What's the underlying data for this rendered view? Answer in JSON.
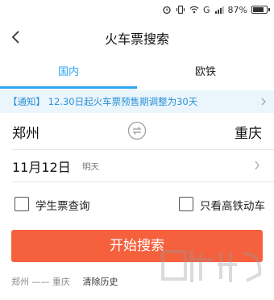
{
  "status_bar": {
    "battery_text": "87%",
    "battery_level": 0.87,
    "icons": [
      "alarm-icon",
      "vibrate-icon",
      "wifi-icon",
      "signal-icon",
      "battery-icon"
    ],
    "network_label": "G"
  },
  "header": {
    "title": "火车票搜索",
    "back_icon": "chevron-left-icon"
  },
  "tabs": [
    {
      "label": "国内",
      "active": true
    },
    {
      "label": "欧铁",
      "active": false
    }
  ],
  "notice": {
    "text": "【通知】 12.30日起火车票预售期调整为30天"
  },
  "route": {
    "from": "郑州",
    "to": "重庆",
    "swap_icon": "swap-icon"
  },
  "date": {
    "value": "11月12日",
    "relative": "明天"
  },
  "options": {
    "student": {
      "label": "学生票查询",
      "checked": false
    },
    "high_speed": {
      "label": "只看高铁动车",
      "checked": false
    }
  },
  "search_button": {
    "label": "开始搜索"
  },
  "history": {
    "route": "郑州 —— 重庆",
    "clear_label": "清除历史"
  },
  "colors": {
    "accent": "#2ba6f0",
    "button": "#f5603d",
    "notice_bg": "#eaf5fc"
  }
}
